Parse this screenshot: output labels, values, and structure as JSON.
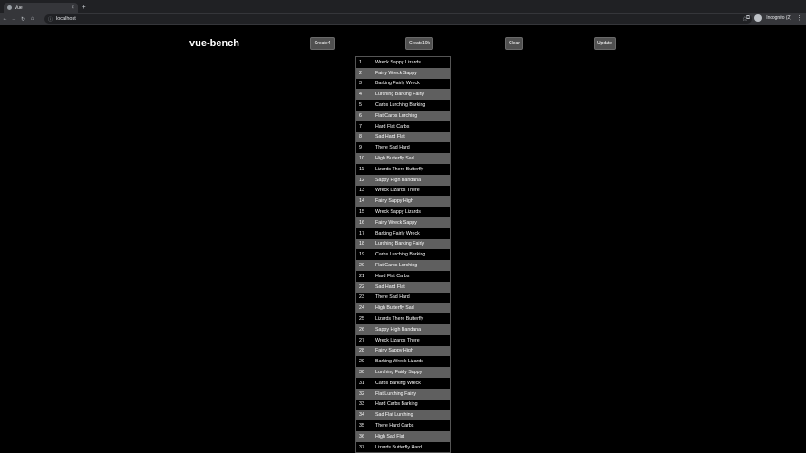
{
  "browser": {
    "tab_title": "Vue",
    "tab_close": "×",
    "new_tab": "+",
    "address": "localhost",
    "incognito_label": "Incognito (2)"
  },
  "app": {
    "heading": "vue-bench",
    "buttons": {
      "create": "Create4",
      "create10k": "Create10k",
      "clear": "Clear",
      "update": "Update"
    }
  },
  "rows": [
    [
      "1",
      "Wreck Sappy Lizards"
    ],
    [
      "2",
      "Fairly Wreck Sappy"
    ],
    [
      "3",
      "Barking Fairly Wreck"
    ],
    [
      "4",
      "Lurching Barking Fairly"
    ],
    [
      "5",
      "Carbs Lurching Barking"
    ],
    [
      "6",
      "Flat Carbs Lurching"
    ],
    [
      "7",
      "Hard Flat Carbs"
    ],
    [
      "8",
      "Sad Hard Flat"
    ],
    [
      "9",
      "There Sad Hard"
    ],
    [
      "10",
      "High Butterfly Sad"
    ],
    [
      "11",
      "Lizards There Butterfly"
    ],
    [
      "12",
      "Sappy High Bandana"
    ],
    [
      "13",
      "Wreck Lizards There"
    ],
    [
      "14",
      "Fairly Sappy High"
    ],
    [
      "15",
      "Wreck Sappy Lizards"
    ],
    [
      "16",
      "Fairly Wreck Sappy"
    ],
    [
      "17",
      "Barking Fairly Wreck"
    ],
    [
      "18",
      "Lurching Barking Fairly"
    ],
    [
      "19",
      "Carbs Lurching Barking"
    ],
    [
      "20",
      "Flat Carbs Lurching"
    ],
    [
      "21",
      "Hard Flat Carbs"
    ],
    [
      "22",
      "Sad Hard Flat"
    ],
    [
      "23",
      "There Sad Hard"
    ],
    [
      "24",
      "High Butterfly Sad"
    ],
    [
      "25",
      "Lizards There Butterfly"
    ],
    [
      "26",
      "Sappy High Bandana"
    ],
    [
      "27",
      "Wreck Lizards There"
    ],
    [
      "28",
      "Fairly Sappy High"
    ],
    [
      "29",
      "Barking Wreck Lizards"
    ],
    [
      "30",
      "Lurching Fairly Sappy"
    ],
    [
      "31",
      "Carbs Barking Wreck"
    ],
    [
      "32",
      "Flat Lurching Fairly"
    ],
    [
      "33",
      "Hard Carbs Barking"
    ],
    [
      "34",
      "Sad Flat Lurching"
    ],
    [
      "35",
      "There Hard Carbs"
    ],
    [
      "36",
      "High Sad Flat"
    ],
    [
      "37",
      "Lizards Butterfly Hard"
    ]
  ]
}
